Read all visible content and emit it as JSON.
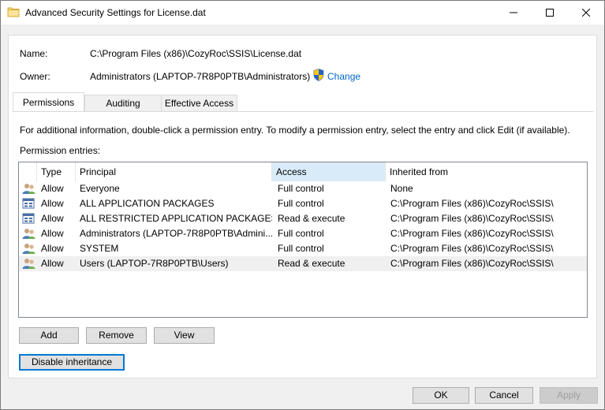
{
  "window": {
    "title": "Advanced Security Settings for License.dat",
    "icon": "folder-icon",
    "controls": [
      "minimize-icon",
      "maximize-icon",
      "close-icon"
    ]
  },
  "info": {
    "name_label": "Name:",
    "name_value": "C:\\Program Files (x86)\\CozyRoc\\SSIS\\License.dat",
    "owner_label": "Owner:",
    "owner_value": "Administrators (LAPTOP-7R8P0PTB\\Administrators)",
    "change_link": "Change",
    "change_icon": "uac-shield-icon"
  },
  "tabs": [
    {
      "label": "Permissions",
      "active": true
    },
    {
      "label": "Auditing",
      "active": false
    },
    {
      "label": "Effective Access",
      "active": false
    }
  ],
  "instructions": "For additional information, double-click a permission entry. To modify a permission entry, select the entry and click Edit (if available).",
  "entries_label": "Permission entries:",
  "table": {
    "columns": [
      "Type",
      "Principal",
      "Access",
      "Inherited from"
    ],
    "sorted_column": "Access",
    "rows": [
      {
        "icon": "user-group-icon",
        "type": "Allow",
        "principal": "Everyone",
        "access": "Full control",
        "inherited": "None"
      },
      {
        "icon": "app-package-icon",
        "type": "Allow",
        "principal": "ALL APPLICATION PACKAGES",
        "access": "Full control",
        "inherited": "C:\\Program Files (x86)\\CozyRoc\\SSIS\\"
      },
      {
        "icon": "app-package-icon",
        "type": "Allow",
        "principal": "ALL RESTRICTED APPLICATION PACKAGES",
        "access": "Read & execute",
        "inherited": "C:\\Program Files (x86)\\CozyRoc\\SSIS\\"
      },
      {
        "icon": "user-group-icon",
        "type": "Allow",
        "principal": "Administrators (LAPTOP-7R8P0PTB\\Admini...",
        "access": "Full control",
        "inherited": "C:\\Program Files (x86)\\CozyRoc\\SSIS\\"
      },
      {
        "icon": "user-group-icon",
        "type": "Allow",
        "principal": "SYSTEM",
        "access": "Full control",
        "inherited": "C:\\Program Files (x86)\\CozyRoc\\SSIS\\"
      },
      {
        "icon": "user-group-icon",
        "type": "Allow",
        "principal": "Users (LAPTOP-7R8P0PTB\\Users)",
        "access": "Read & execute",
        "inherited": "C:\\Program Files (x86)\\CozyRoc\\SSIS\\",
        "selected": true
      }
    ]
  },
  "buttons": {
    "add": "Add",
    "remove": "Remove",
    "view": "View",
    "disable_inheritance": "Disable inheritance",
    "ok": "OK",
    "cancel": "Cancel",
    "apply": "Apply"
  },
  "colors": {
    "link": "#0066cc",
    "sorted_header": "#d9ebf9",
    "focus_border": "#0078d7"
  }
}
